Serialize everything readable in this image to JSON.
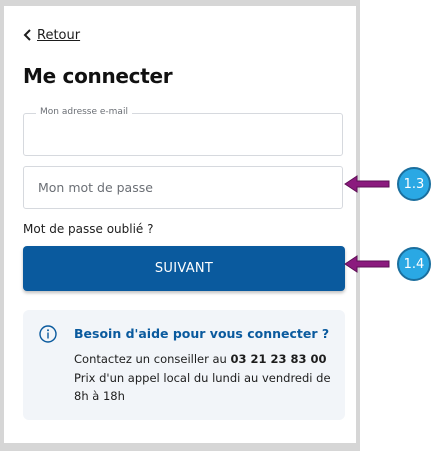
{
  "nav": {
    "back_label": "Retour",
    "back_icon": "chevron-left-icon"
  },
  "page": {
    "title": "Me connecter"
  },
  "form": {
    "email_label": "Mon adresse e-mail",
    "email_value": "",
    "password_placeholder": "Mon mot de passe",
    "forgot_label": "Mot de passe oublié ?",
    "submit_label": "SUIVANT"
  },
  "help": {
    "icon": "info-icon",
    "title": "Besoin d'aide pour vous connecter ?",
    "line1_prefix": "Contactez un conseiller au ",
    "phone": "03 21 23 83 00",
    "line2": "Prix d'un appel local du lundi au vendredi de",
    "line3": "8h à 18h"
  },
  "annotations": [
    {
      "label": "1.3",
      "target": "password-field"
    },
    {
      "label": "1.4",
      "target": "submit-button"
    }
  ],
  "colors": {
    "primary": "#0a5a9e",
    "help_bg": "#f2f5f9",
    "annotation_arrow": "#8b1a7e",
    "annotation_badge": "#2aa8e4"
  }
}
